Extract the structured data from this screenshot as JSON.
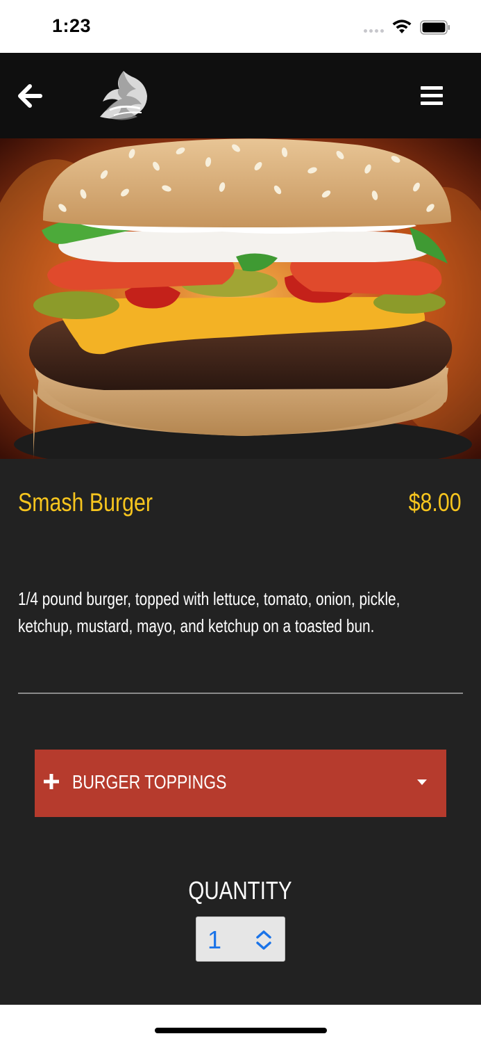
{
  "status_bar": {
    "time": "1:23"
  },
  "header": {
    "back_icon": "arrow-left-icon",
    "logo_icon": "brand-logo-icon",
    "menu_icon": "hamburger-menu-icon"
  },
  "product": {
    "image": "burger-photo",
    "name": "Smash Burger",
    "price": "$8.00",
    "description": "1/4 pound burger, topped with lettuce, tomato, onion, pickle, ketchup, mustard, mayo, and ketchup on a toasted bun."
  },
  "options": {
    "accordion_label": "BURGER TOPPINGS",
    "expand_icon": "plus-icon",
    "caret_icon": "caret-down-icon"
  },
  "quantity": {
    "label": "QUANTITY",
    "value": "1"
  },
  "colors": {
    "accent": "#f7c51e",
    "accordion": "#b63b2d",
    "panel": "#222222",
    "header": "#0f0f0f"
  }
}
